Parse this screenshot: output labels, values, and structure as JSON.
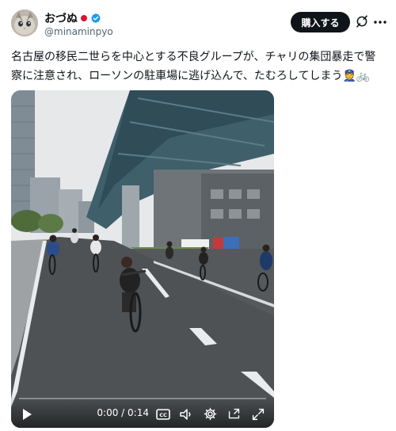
{
  "user": {
    "display_name": "おづぬ",
    "handle": "@minaminpyo"
  },
  "header": {
    "buy_label": "購入する"
  },
  "post": {
    "text": "名古屋の移民二世らを中心とする不良グループが、チャリの集団暴走で警察に注意され、ローソンの駐車場に逃げ込んで、たむろしてしまう",
    "emojis": "👮🚲"
  },
  "video": {
    "time_display": "0:00 / 0:14",
    "progress": 0.0
  },
  "colors": {
    "verified": "#1d9bf0",
    "flag": "#d8132f",
    "button_bg": "#0f1419"
  },
  "icons": [
    "verified-badge-icon",
    "grok-icon",
    "play-icon",
    "captions-icon",
    "volume-icon",
    "settings-icon",
    "pip-icon",
    "fullscreen-icon"
  ]
}
